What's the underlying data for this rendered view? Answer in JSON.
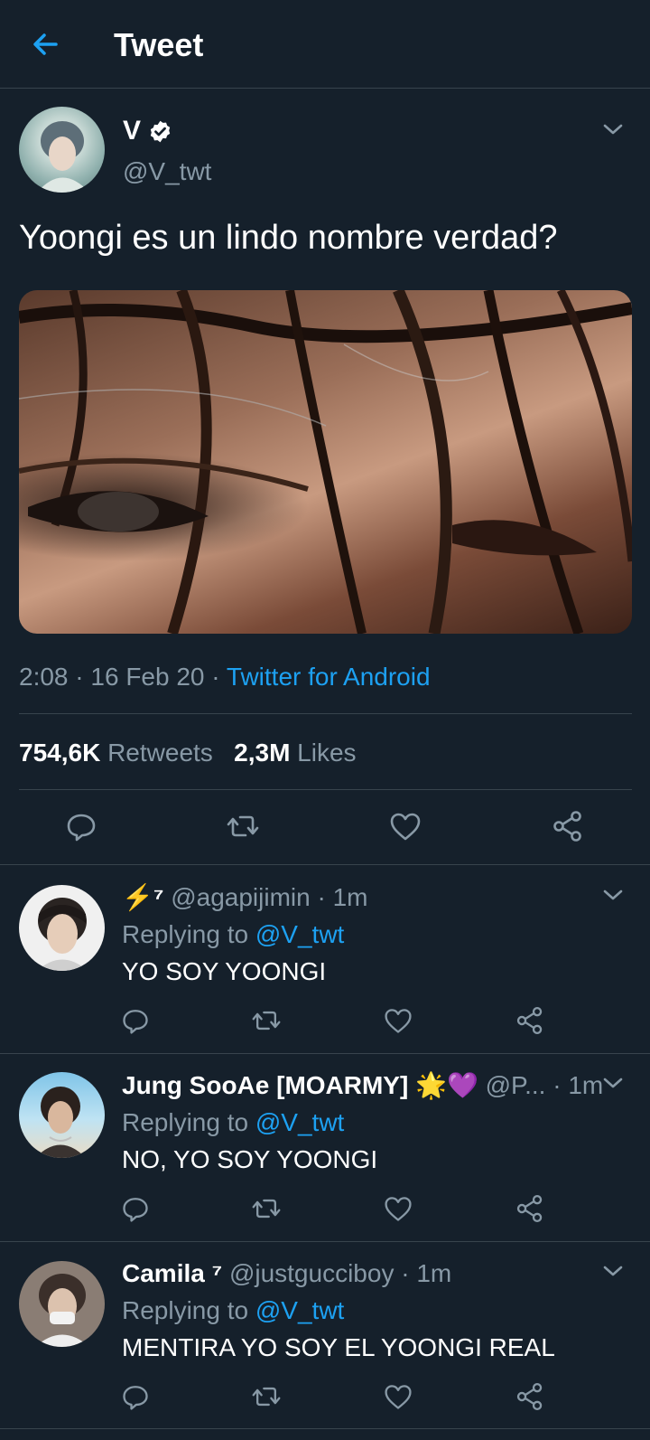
{
  "header": {
    "title": "Tweet"
  },
  "tweet": {
    "name": "V",
    "handle": "@V_twt",
    "text": "Yoongi es un lindo nombre verdad?",
    "time": "2:08",
    "date": "16 Feb 20",
    "source": "Twitter for Android",
    "dot": "·",
    "retweets_count": "754,6K",
    "retweets_label": "Retweets",
    "likes_count": "2,3M",
    "likes_label": "Likes"
  },
  "replies": [
    {
      "name": "⚡⁷",
      "handle": "@agapijimin",
      "time": "· 1m",
      "replying_label": "Replying to",
      "replying_to": "@V_twt",
      "text": "YO SOY YOONGI"
    },
    {
      "name": "Jung SooAe [MOARMY] 🌟💜",
      "handle": "@P...",
      "time": "· 1m",
      "replying_label": "Replying to",
      "replying_to": "@V_twt",
      "text": "NO, YO SOY YOONGI"
    },
    {
      "name": "Camila ⁷",
      "handle": "@justgucciboy",
      "time": "· 1m",
      "replying_label": "Replying to",
      "replying_to": "@V_twt",
      "text": "MENTIRA YO SOY EL YOONGI REAL"
    }
  ],
  "colors": {
    "background": "#15202b",
    "accent": "#1da1f2",
    "muted": "#8899a6",
    "divider": "#38444d"
  },
  "icons": [
    "back-arrow-icon",
    "verified-badge-icon",
    "chevron-down-icon",
    "reply-icon",
    "retweet-icon",
    "like-icon",
    "share-icon"
  ]
}
